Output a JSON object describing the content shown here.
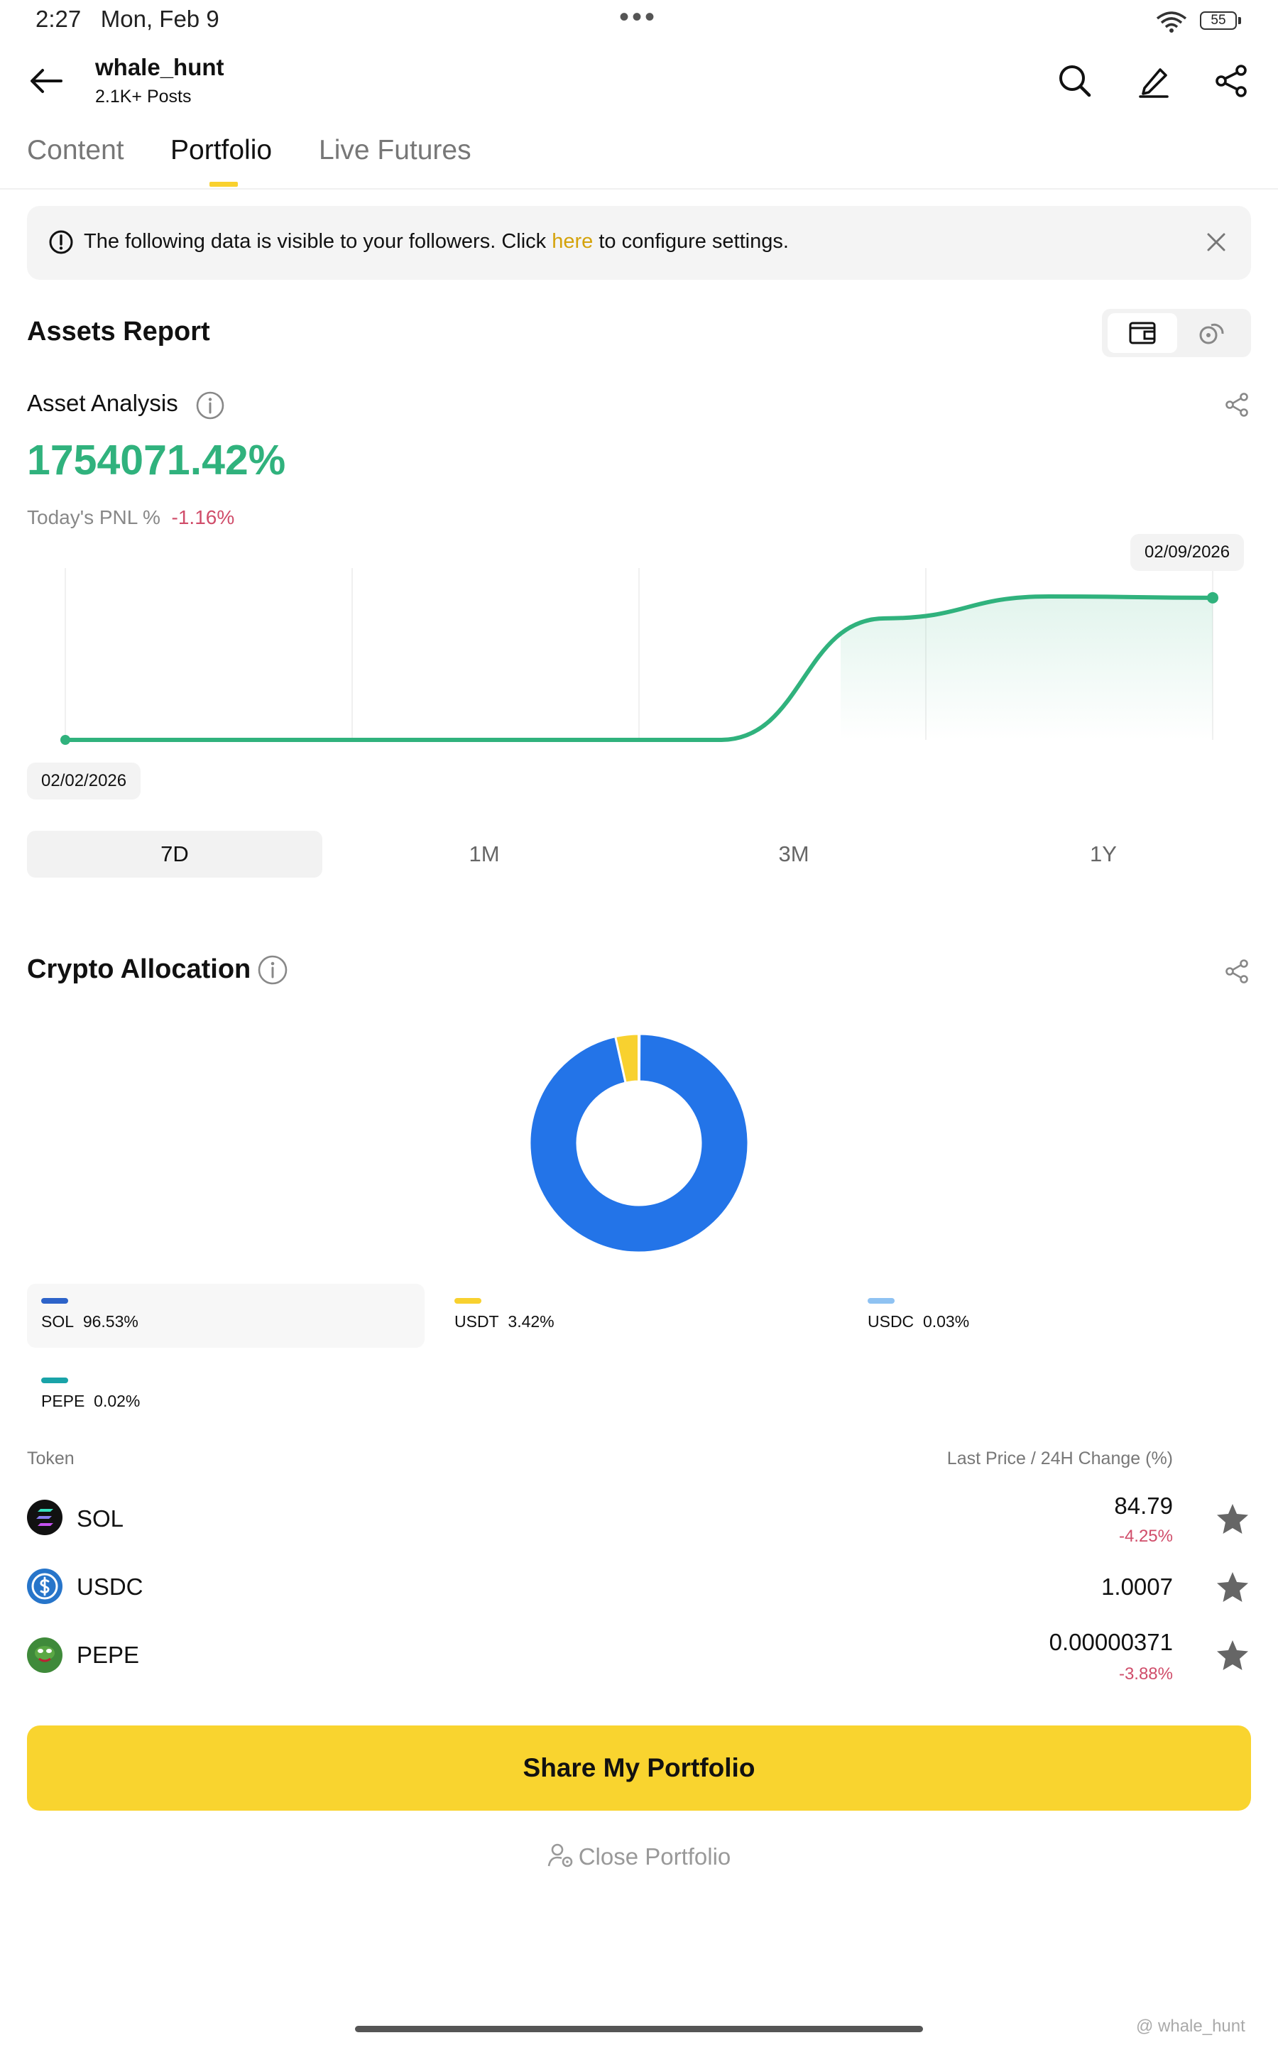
{
  "status_bar": {
    "time": "2:27",
    "date": "Mon, Feb 9",
    "dots": "•••",
    "battery": "55"
  },
  "header": {
    "username": "whale_hunt",
    "posts": "2.1K+ Posts"
  },
  "tabs": [
    {
      "label": "Content"
    },
    {
      "label": "Portfolio",
      "active": true
    },
    {
      "label": "Live Futures"
    }
  ],
  "notice": {
    "text_before": "The following data is visible to your followers. Click ",
    "link": "here",
    "text_after": " to configure settings."
  },
  "assets_report": {
    "title": "Assets Report",
    "analysis_label": "Asset Analysis",
    "total_pnl_percent": "1754071.42%",
    "today_pnl_label": "Today's PNL %",
    "today_pnl_value": "-1.16%"
  },
  "chart_data": {
    "type": "line",
    "start_label": "02/02/2026",
    "end_label": "02/09/2026",
    "x": [
      "02/02/2026",
      "02/03/2026",
      "02/04/2026",
      "02/05/2026",
      "02/06/2026",
      "02/07/2026",
      "02/08/2026",
      "02/09/2026"
    ],
    "y": [
      0,
      0,
      0,
      0,
      0,
      1500000,
      1770000,
      1754071.42
    ],
    "color": "#30b27d",
    "grid": true
  },
  "ranges": [
    {
      "label": "7D",
      "active": true
    },
    {
      "label": "1M"
    },
    {
      "label": "3M"
    },
    {
      "label": "1Y"
    }
  ],
  "allocation": {
    "title": "Crypto Allocation",
    "chart_data": {
      "type": "pie",
      "labels": [
        "SOL",
        "USDT",
        "USDC",
        "PEPE"
      ],
      "values": [
        96.53,
        3.42,
        0.03,
        0.02
      ],
      "colors": [
        "#2374e8",
        "#f8d12f",
        "#8fc2f2",
        "#19a3a8"
      ]
    },
    "legend": [
      {
        "name": "SOL",
        "value": "96.53%",
        "color": "#2d63c9"
      },
      {
        "name": "USDT",
        "value": "3.42%",
        "color": "#f8d12f"
      },
      {
        "name": "USDC",
        "value": "0.03%",
        "color": "#8fc2f2"
      },
      {
        "name": "PEPE",
        "value": "0.02%",
        "color": "#19a3a8"
      }
    ]
  },
  "tokens": {
    "header_token": "Token",
    "header_price": "Last Price / 24H Change (%)",
    "rows": [
      {
        "name": "SOL",
        "price": "84.79",
        "change": "-4.25%"
      },
      {
        "name": "USDC",
        "price": "1.0007",
        "change": ""
      },
      {
        "name": "PEPE",
        "price": "0.00000371",
        "change": "-3.88%"
      }
    ]
  },
  "actions": {
    "share_label": "Share My Portfolio",
    "close_label": "Close Portfolio"
  },
  "watermark": "@ whale_hunt",
  "colors": {
    "accent_yellow": "#f9d42f",
    "positive_green": "#30b27d",
    "negative_red": "#d04d6a"
  }
}
